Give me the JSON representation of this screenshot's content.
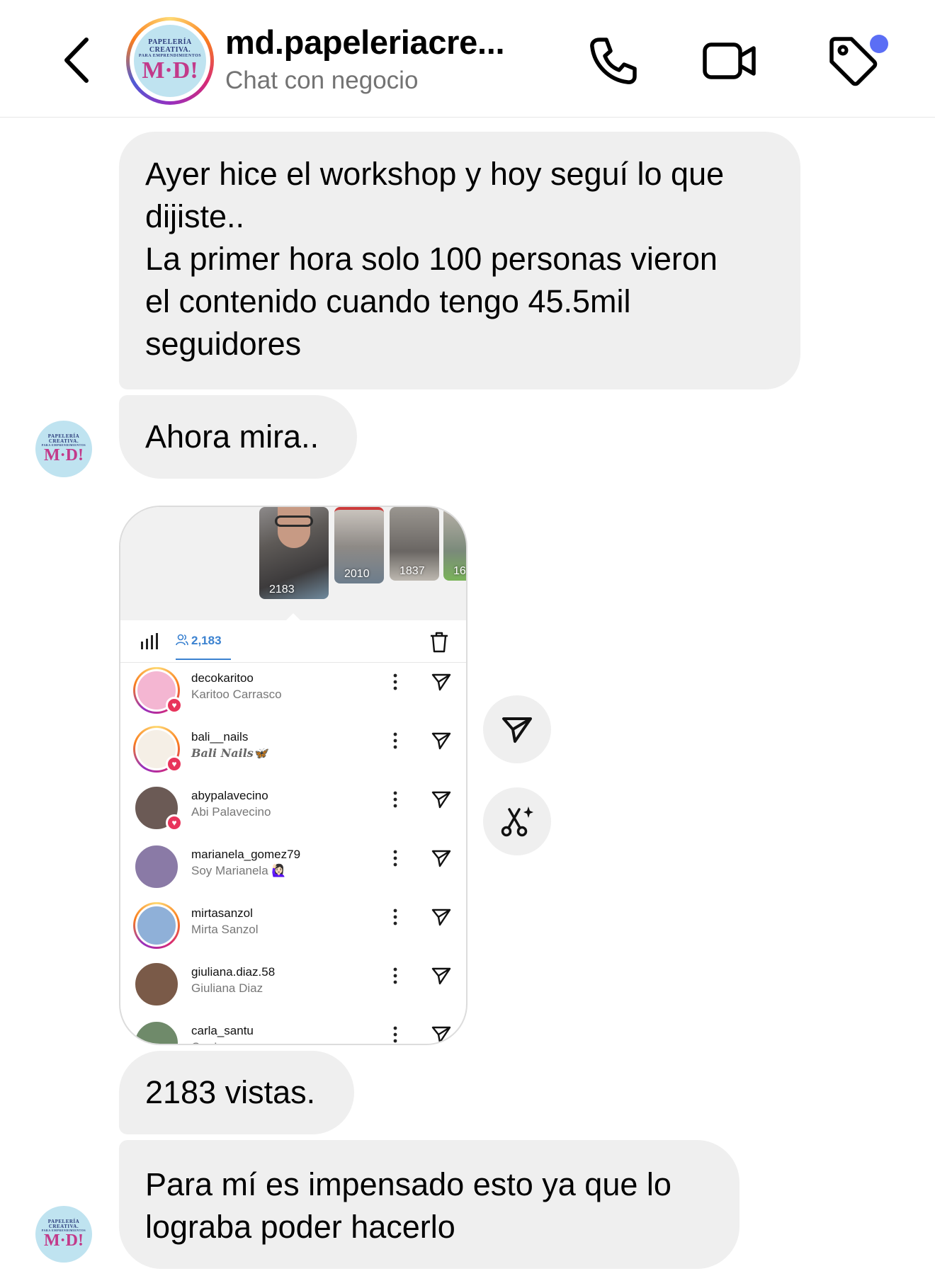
{
  "header": {
    "contact_name": "md.papeleriacre...",
    "subtitle": "Chat con negocio",
    "back_icon": "chevron-left-icon",
    "call_icon": "phone-icon",
    "video_icon": "video-camera-icon",
    "tag_icon": "tag-icon",
    "notification_dot_color": "#5b6ef5"
  },
  "logo": {
    "line1": "PAPELERÍA",
    "line2": "CREATIVA.",
    "line3": "PARA EMPRENDIMIENTOS",
    "mark": "M·D!"
  },
  "messages": [
    {
      "text": "Ayer hice el workshop y hoy seguí lo que\ndijiste..\nLa primer hora solo 100 personas vieron\nel contenido cuando tengo 45.5mil\nseguidores"
    },
    {
      "text": "Ahora mira.."
    },
    {
      "text": "2183 vistas."
    },
    {
      "text": "Para mí es impensado esto ya que lo\nlograba poder hacerlo"
    }
  ],
  "shared_story": {
    "thumbnails": [
      {
        "count": "2183"
      },
      {
        "count": "2010"
      },
      {
        "count": "1837"
      },
      {
        "count": "16"
      }
    ],
    "viewers_count": "2,183",
    "viewers": [
      {
        "username": "decokaritoo",
        "name": "Karitoo Carrasco",
        "ring": true,
        "liked": true,
        "avatar_color": "#f4b6d2"
      },
      {
        "username": "bali__nails",
        "name": "Bali Nails🦋",
        "ring": true,
        "liked": true,
        "avatar_color": "#f5efe6"
      },
      {
        "username": "abypalavecino",
        "name": "Abi Palavecino",
        "ring": false,
        "liked": true,
        "avatar_color": "#6b5a55"
      },
      {
        "username": "marianela_gomez79",
        "name": "Soy Marianela 🙋🏻‍♀️",
        "ring": false,
        "liked": false,
        "avatar_color": "#8a7aa6"
      },
      {
        "username": "mirtasanzol",
        "name": "Mirta Sanzol",
        "ring": true,
        "liked": false,
        "avatar_color": "#8fb0d8"
      },
      {
        "username": "giuliana.diaz.58",
        "name": "Giuliana Diaz",
        "ring": false,
        "liked": false,
        "avatar_color": "#7a5a48"
      },
      {
        "username": "carla_santu",
        "name": "Car La",
        "ring": false,
        "liked": false,
        "avatar_color": "#6f8a6a"
      }
    ]
  },
  "side_actions": {
    "share_icon": "paper-plane-icon",
    "remix_icon": "scissors-sparkle-icon"
  }
}
